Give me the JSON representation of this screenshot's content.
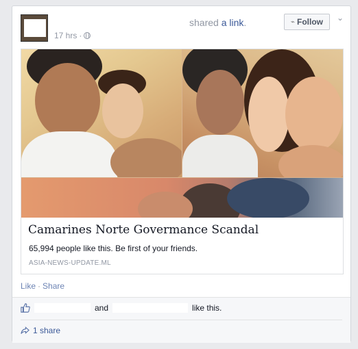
{
  "post": {
    "action_prefix": "shared ",
    "action_link": "a link",
    "action_suffix": ".",
    "time": "17 hrs",
    "time_sep": "·",
    "follow_label": "Follow"
  },
  "attachment": {
    "title": "Camarines Norte Govermance Scandal",
    "likes_text": "65,994 people like this. Be first of your friends.",
    "domain": "ASIA-NEWS-UPDATE.ML"
  },
  "actions": {
    "like": "Like",
    "sep": "·",
    "share": "Share"
  },
  "feedback": {
    "and_text": "and",
    "like_suffix": "like this.",
    "share_count": "1 share"
  },
  "colors": {
    "link": "#3b5998",
    "muted": "#9197a3",
    "panel": "#f6f7f9"
  },
  "icons": [
    "globe-icon",
    "rss-icon",
    "chevron-down-icon",
    "thumbs-up-icon",
    "share-arrow-icon"
  ]
}
